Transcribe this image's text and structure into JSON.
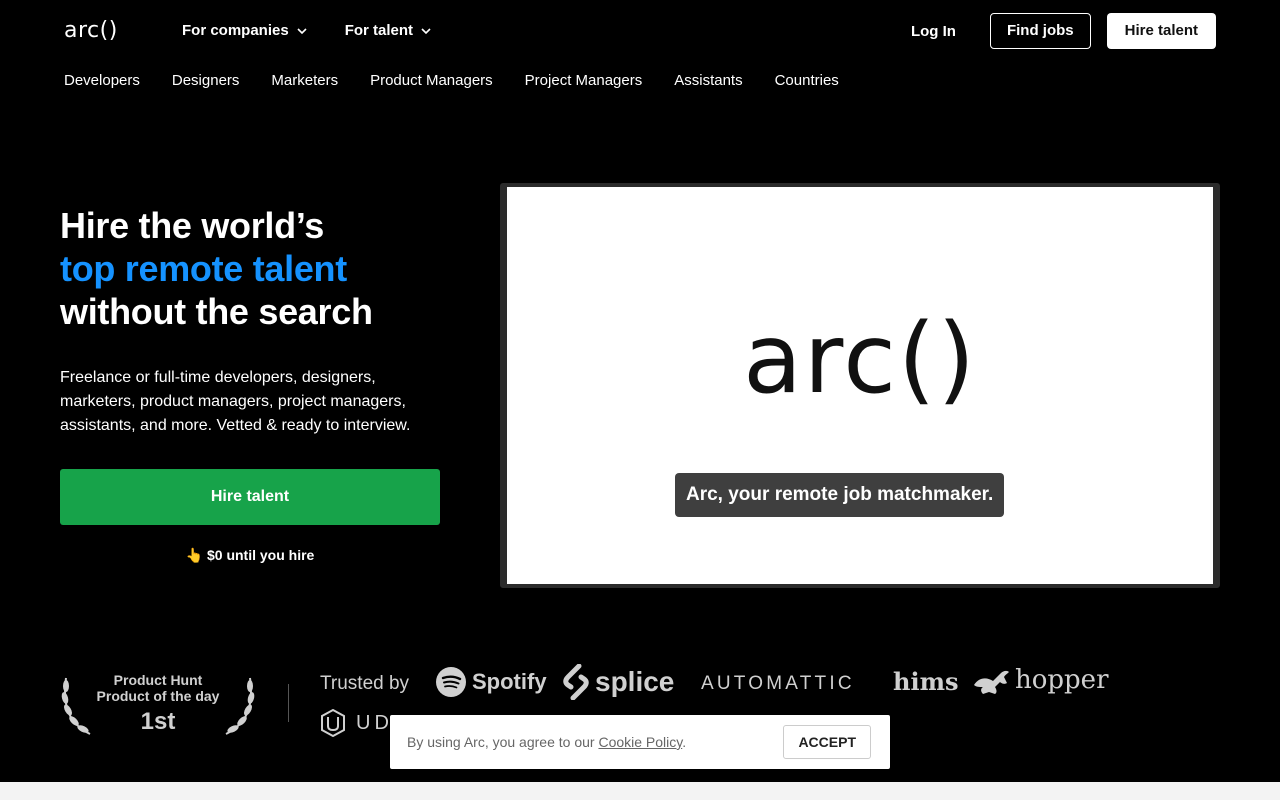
{
  "header": {
    "logo": "arc()",
    "nav": [
      {
        "label": "For companies"
      },
      {
        "label": "For talent"
      }
    ],
    "login": "Log In",
    "find_jobs": "Find jobs",
    "hire_talent": "Hire talent"
  },
  "subnav": [
    "Developers",
    "Designers",
    "Marketers",
    "Product Managers",
    "Project Managers",
    "Assistants",
    "Countries"
  ],
  "hero": {
    "title_line1": "Hire the world’s",
    "title_line2": "top remote talent",
    "title_line3": "without the search",
    "description": "Freelance or full-time developers, designers, marketers, product managers, project managers, assistants, and more. Vetted & ready to interview.",
    "cta": "Hire talent",
    "note_emoji": "👆",
    "note": "$0 until you hire"
  },
  "video": {
    "logo": "arc()",
    "caption": "Arc, your remote job matchmaker."
  },
  "badges": {
    "product_hunt_line1": "Product Hunt",
    "product_hunt_line2": "Product of the day",
    "product_hunt_rank": "1st"
  },
  "trusted": {
    "label": "Trusted by",
    "brands": [
      "Spotify",
      "splice",
      "AUTOMATTIC",
      "hims",
      "hopper",
      "UD"
    ]
  },
  "cookie": {
    "text": "By using Arc, you agree to our",
    "link": "Cookie Policy",
    "period": ".",
    "accept": "ACCEPT"
  },
  "colors": {
    "accent_blue": "#1592ff",
    "cta_green": "#17a34a",
    "background": "#000000"
  }
}
